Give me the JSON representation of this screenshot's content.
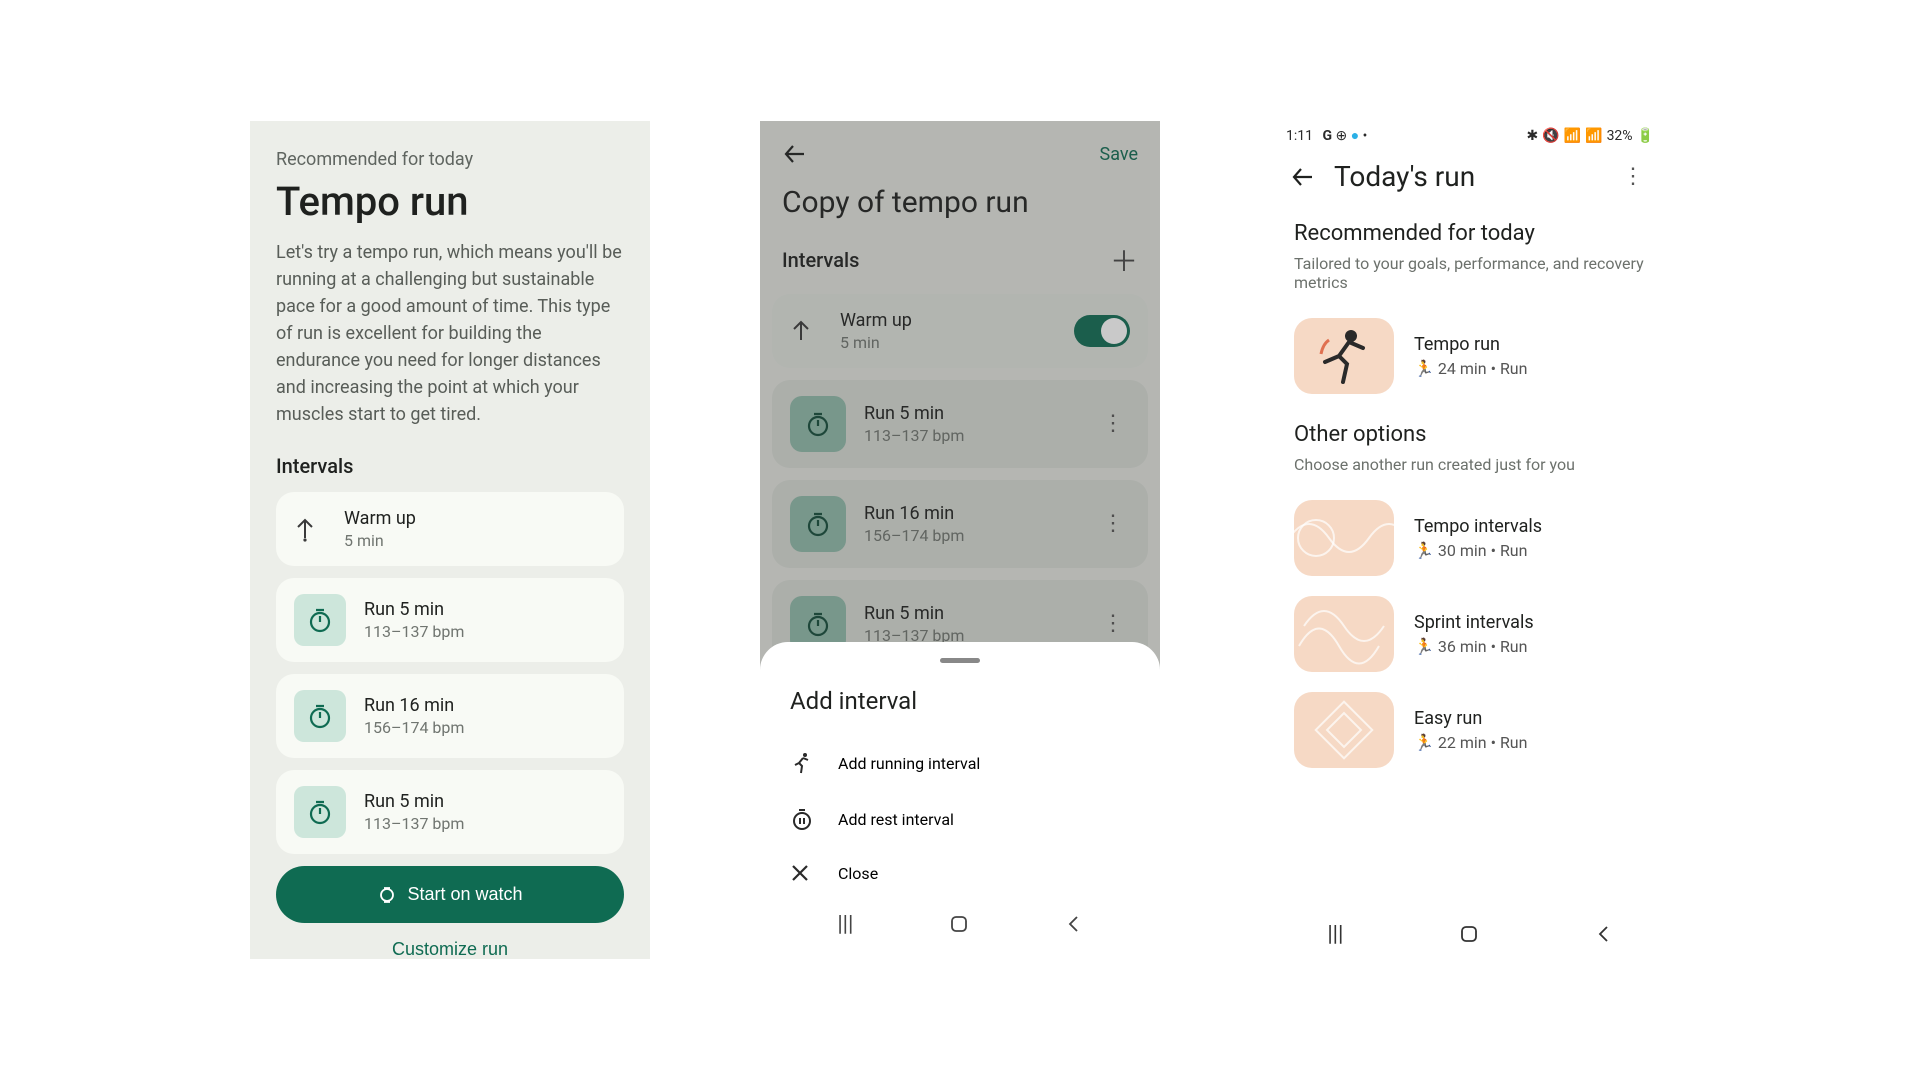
{
  "screen1": {
    "recommended": "Recommended for today",
    "title": "Tempo run",
    "description": "Let's try a tempo run, which means you'll be running at a challenging but sustainable pace for a good amount of time. This type of run is excellent for building the endurance you need for longer distances and increasing the point at which your muscles start to get tired.",
    "section": "Intervals",
    "intervals": [
      {
        "title": "Warm up",
        "sub": "5 min",
        "icon": "arrow"
      },
      {
        "title": "Run 5 min",
        "sub": "113–137 bpm",
        "icon": "stopwatch"
      },
      {
        "title": "Run 16 min",
        "sub": "156–174 bpm",
        "icon": "stopwatch"
      },
      {
        "title": "Run 5 min",
        "sub": "113–137 bpm",
        "icon": "stopwatch"
      }
    ],
    "start_label": "Start on watch",
    "customize_label": "Customize run"
  },
  "screen2": {
    "save": "Save",
    "title": "Copy of tempo run",
    "section": "Intervals",
    "intervals": [
      {
        "title": "Warm up",
        "sub": "5 min",
        "type": "toggle"
      },
      {
        "title": "Run 5 min",
        "sub": "113–137 bpm",
        "type": "menu"
      },
      {
        "title": "Run 16 min",
        "sub": "156–174 bpm",
        "type": "menu"
      },
      {
        "title": "Run 5 min",
        "sub": "113–137 bpm",
        "type": "menu"
      }
    ],
    "sheet": {
      "title": "Add interval",
      "running": "Add running interval",
      "rest": "Add rest interval",
      "close": "Close"
    }
  },
  "screen3": {
    "status_time": "1:11",
    "status_battery": "32%",
    "appbar_title": "Today's run",
    "rec_heading": "Recommended for today",
    "rec_sub": "Tailored to your goals, performance, and recovery metrics",
    "rec_item": {
      "title": "Tempo run",
      "sub": "24 min • Run"
    },
    "other_heading": "Other options",
    "other_sub": "Choose another run created just for you",
    "others": [
      {
        "title": "Tempo intervals",
        "sub": "30 min • Run"
      },
      {
        "title": "Sprint intervals",
        "sub": "36 min • Run"
      },
      {
        "title": "Easy run",
        "sub": "22 min • Run"
      }
    ]
  }
}
